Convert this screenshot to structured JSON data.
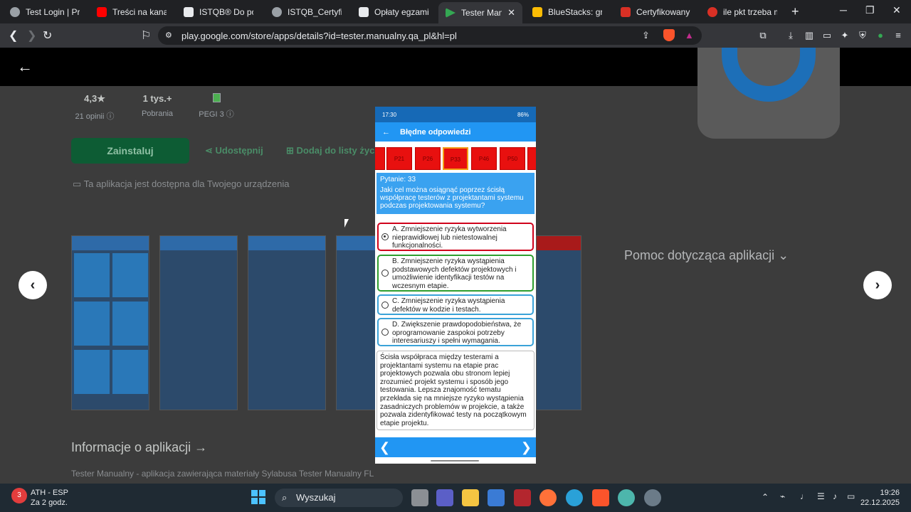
{
  "browser": {
    "tabs": [
      {
        "title": "Test Login | Practic",
        "color": "#9aa0a6"
      },
      {
        "title": "Treści na kanale - \\",
        "color": "#ff0000"
      },
      {
        "title": "ISTQB® Do pobra",
        "color": "#e8eaed"
      },
      {
        "title": "ISTQB_Certyfikowa",
        "color": "#9aa0a6"
      },
      {
        "title": "Opłaty egzaminac",
        "color": "#e8eaed"
      },
      {
        "title": "Tester Manual",
        "color": "#34a853"
      },
      {
        "title": "BlueStacks: graj w",
        "color": "#fbbc04"
      },
      {
        "title": "Certyfikowany test",
        "color": "#d93025"
      },
      {
        "title": "ile pkt trzeba mieć",
        "color": "#d93025"
      }
    ],
    "url": "play.google.com/store/apps/details?id=tester.manualny.qa_pl&hl=pl"
  },
  "store": {
    "rating": "4,3★",
    "reviews": "21 opinii ⓘ",
    "downloads": "1 tys.+",
    "downloads_label": "Pobrania",
    "pegi": "PEGI 3 ⓘ",
    "install": "Zainstaluj",
    "share": "Udostępnij",
    "wishlist": "Dodaj do listy życz",
    "available": "Ta aplikacja jest dostępna dla Twojego urządzenia",
    "help": "Pomoc dotycząca aplikacji",
    "info_title": "Informacje o aplikacji",
    "description": "Tester Manualny - aplikacja zawierająca materiały Sylabusa Tester Manualny FL"
  },
  "phone": {
    "time": "17:30",
    "battery": "86%",
    "title": "Błędne odpowiedzi",
    "question_buttons": [
      "P21",
      "P26",
      "P33",
      "P46",
      "P50"
    ],
    "question_number": "Pytanie: 33",
    "question": "Jaki cel można osiągnąć poprzez ścisłą współpracę testerów z projektantami systemu podczas projektowania systemu?",
    "answers": [
      {
        "text": "A. Zmniejszenie ryzyka wytworzenia nieprawidłowej lub nietestowalnej funkcjonalności.",
        "border": "#d0021b",
        "selected": true
      },
      {
        "text": "B. Zmniejszenie ryzyka wystąpienia podstawowych defektów projektowych i umożliwienie identyfikacji testów na wczesnym etapie.",
        "border": "#2e9e2e",
        "selected": false
      },
      {
        "text": "C. Zmniejszenie ryzyka wystąpienia defektów w kodzie i testach.",
        "border": "#3aa2d8",
        "selected": false
      },
      {
        "text": "D. Zwiększenie prawdopodobieństwa, że oprogramowanie zaspokoi potrzeby interesariuszy i spełni wymagania.",
        "border": "#3aa2d8",
        "selected": false
      }
    ],
    "explanation": "Ścisła współpraca między testerami a projektantami systemu na etapie prac projektowych pozwala obu stronom lepiej zrozumieć projekt systemu i sposób jego testowania. Lepsza znajomość tematu przekłada się na mniejsze ryzyko wystąpienia zasadniczych problemów w projekcie, a także pozwala zidentyfikować testy na początkowym etapie projektu."
  },
  "taskbar": {
    "weather_label": "ATH - ESP",
    "weather_sub": "Za 2 godz.",
    "search": "Wyszukaj",
    "time": "19:26",
    "date": "22.12.2025"
  }
}
